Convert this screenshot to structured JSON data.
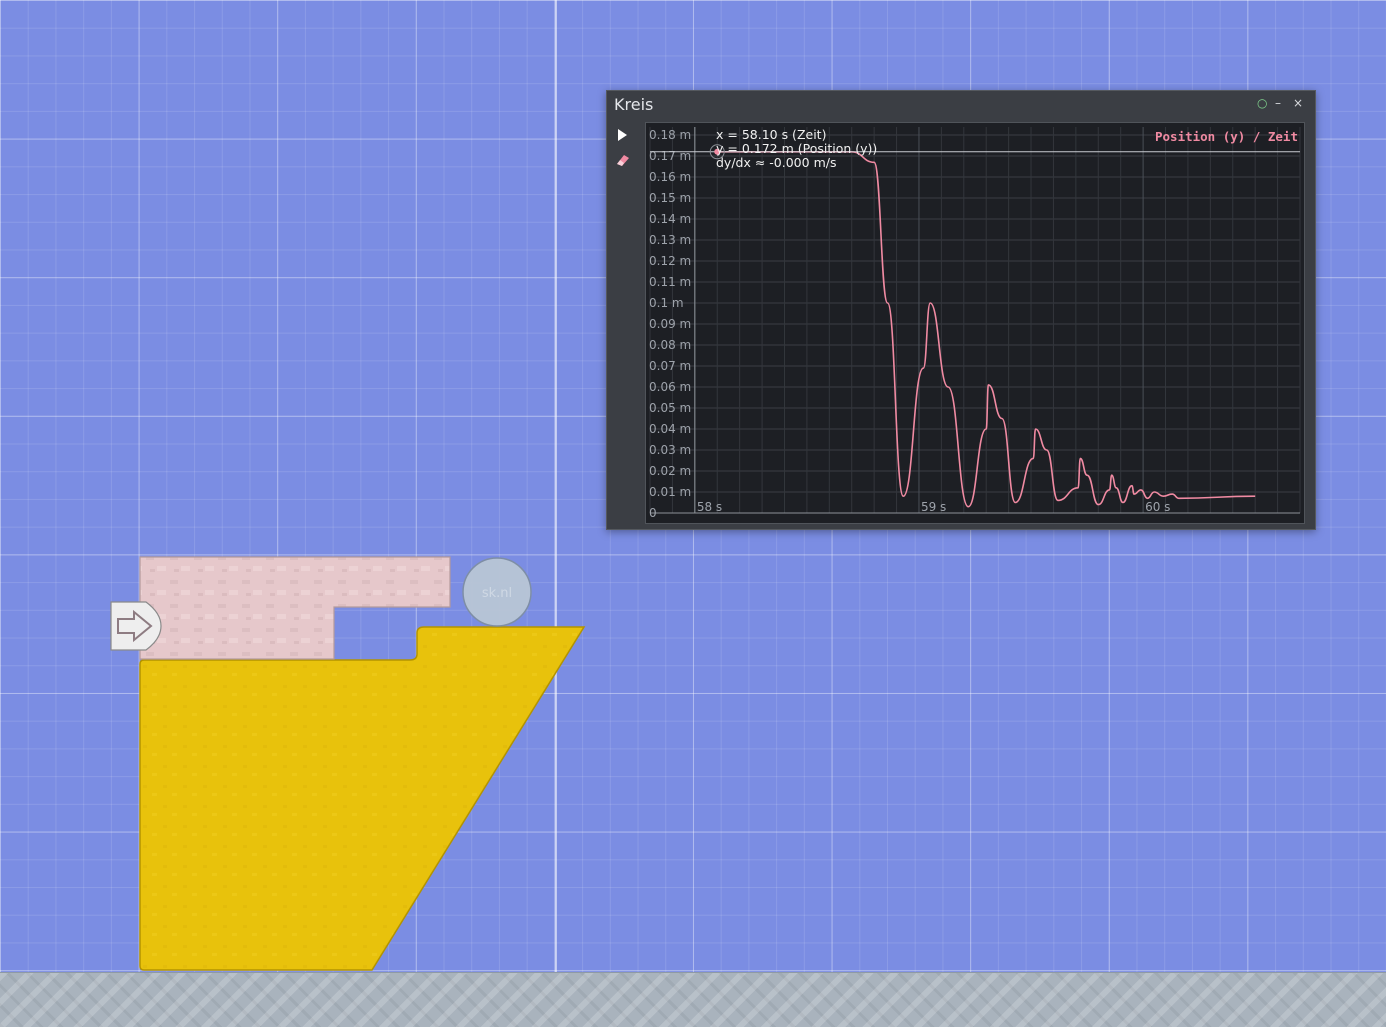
{
  "panel": {
    "title": "Kreis",
    "controls": {
      "pin": "○",
      "minimize": "–",
      "close": "×"
    },
    "tools": {
      "play": "play-icon",
      "eraser": "eraser-icon"
    }
  },
  "readout": {
    "x_line": "x = 58.10 s (Zeit)",
    "y_line": "y = 0.172 m (Position (y))",
    "slope_line": "dy/dx ≈ -0.000 m/s"
  },
  "chart_data": {
    "type": "line",
    "title": "Position (y) / Zeit",
    "xlabel": "Zeit",
    "ylabel": "Position (y)",
    "y_ticks": [
      "0",
      "0.01 m",
      "0.02 m",
      "0.03 m",
      "0.04 m",
      "0.05 m",
      "0.06 m",
      "0.07 m",
      "0.08 m",
      "0.09 m",
      "0.1 m",
      "0.11 m",
      "0.12 m",
      "0.13 m",
      "0.14 m",
      "0.15 m",
      "0.16 m",
      "0.17 m",
      "0.18 m"
    ],
    "x_ticks": [
      "58 s",
      "59 s",
      "60 s"
    ],
    "xlim": [
      57.8,
      60.7
    ],
    "ylim": [
      0,
      0.18
    ],
    "grid": true,
    "cursor": {
      "x": 58.1,
      "y": 0.172
    },
    "series": [
      {
        "color": "#f08aa2",
        "x": [
          58.1,
          58.7,
          58.8,
          58.86,
          58.93,
          59.02,
          59.05,
          59.13,
          59.22,
          59.3,
          59.31,
          59.37,
          59.43,
          59.51,
          59.52,
          59.57,
          59.62,
          59.71,
          59.72,
          59.75,
          59.8,
          59.85,
          59.86,
          59.88,
          59.91,
          59.95,
          59.96,
          59.99,
          60.02,
          60.05,
          60.09,
          60.13,
          60.16,
          60.5
        ],
        "y": [
          0.172,
          0.172,
          0.167,
          0.1,
          0.008,
          0.069,
          0.1,
          0.06,
          0.003,
          0.04,
          0.061,
          0.045,
          0.005,
          0.026,
          0.04,
          0.03,
          0.006,
          0.012,
          0.026,
          0.018,
          0.004,
          0.011,
          0.018,
          0.012,
          0.005,
          0.013,
          0.009,
          0.011,
          0.007,
          0.01,
          0.008,
          0.009,
          0.007,
          0.008
        ]
      }
    ]
  },
  "scene": {
    "colors": {
      "background": "#7b8de3",
      "yellow_block": "#e8c20c",
      "pink_block": "#e6c8cb",
      "ball": "#b9c6d6",
      "ground": "#a9b3bd"
    },
    "ball_label": "sk.nl",
    "objects": [
      "kreis",
      "l-shaped-pink-block",
      "yellow-ramp-block",
      "arrow-marker",
      "ground"
    ]
  }
}
